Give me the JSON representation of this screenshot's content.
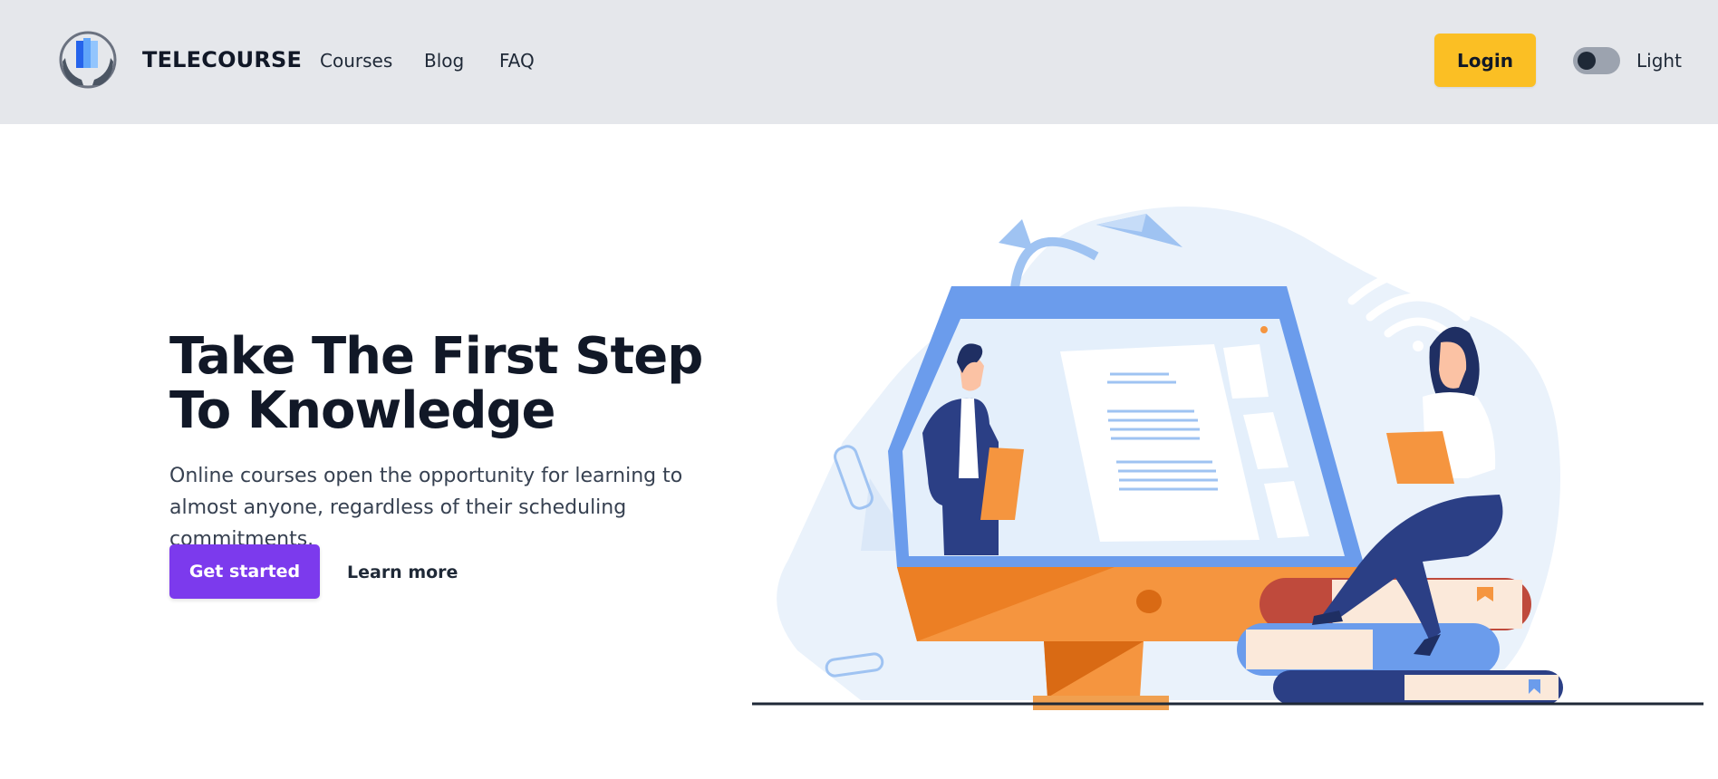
{
  "header": {
    "brand": "TELECOURSE",
    "nav": [
      {
        "label": "Courses"
      },
      {
        "label": "Blog"
      },
      {
        "label": "FAQ"
      }
    ],
    "login_label": "Login",
    "theme_label": "Light"
  },
  "hero": {
    "title_line1": "Take The First Step",
    "title_line2": "To Knowledge",
    "description": "Online courses open the opportunity for learning to almost anyone, regardless of their scheduling commitments.",
    "primary_cta": "Get started",
    "secondary_cta": "Learn more"
  },
  "colors": {
    "nav_bg": "#e5e7eb",
    "login_bg": "#fbbf24",
    "primary_cta_bg": "#7c3aed",
    "illustration_blue": "#6b9cec",
    "illustration_orange": "#f5953f",
    "illustration_navy": "#2b3f85"
  }
}
